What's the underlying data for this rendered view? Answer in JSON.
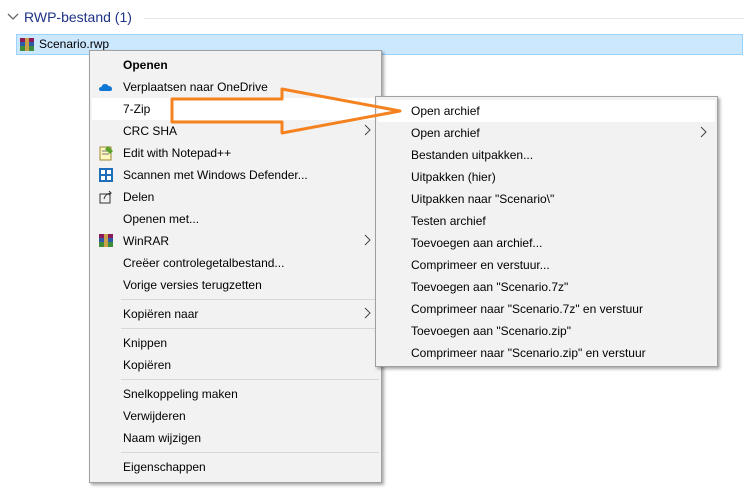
{
  "explorer": {
    "group_title": "RWP-bestand (1)",
    "file_name": "Scenario.rwp"
  },
  "context_menu": {
    "items": [
      {
        "label": "Openen",
        "bold": true
      },
      {
        "label": "Verplaatsen naar OneDrive",
        "icon": "onedrive-icon"
      },
      {
        "label": "7-Zip",
        "submenu": true
      },
      {
        "label": "CRC SHA",
        "submenu": true
      },
      {
        "label": "Edit with Notepad++",
        "icon": "notepad-plus-plus-icon"
      },
      {
        "label": "Scannen met Windows Defender...",
        "icon": "windows-defender-icon"
      },
      {
        "label": "Delen",
        "icon": "share-icon"
      },
      {
        "label": "Openen met..."
      },
      {
        "label": "WinRAR",
        "icon": "winrar-icon",
        "submenu": true
      },
      {
        "label": "Creëer controlegetalbestand..."
      },
      {
        "label": "Vorige versies terugzetten"
      },
      {
        "label": "Kopiëren naar",
        "submenu": true
      },
      {
        "label": "Knippen"
      },
      {
        "label": "Kopiëren"
      },
      {
        "label": "Snelkoppeling maken"
      },
      {
        "label": "Verwijderen"
      },
      {
        "label": "Naam wijzigen"
      },
      {
        "label": "Eigenschappen"
      }
    ]
  },
  "zip_submenu": {
    "items": [
      {
        "label": "Open archief"
      },
      {
        "label": "Open archief",
        "submenu": true
      },
      {
        "label": "Bestanden uitpakken..."
      },
      {
        "label": "Uitpakken (hier)"
      },
      {
        "label": "Uitpakken naar \"Scenario\\\""
      },
      {
        "label": "Testen archief"
      },
      {
        "label": "Toevoegen aan archief..."
      },
      {
        "label": "Comprimeer en verstuur..."
      },
      {
        "label": "Toevoegen aan \"Scenario.7z\""
      },
      {
        "label": "Comprimeer naar \"Scenario.7z\" en verstuur"
      },
      {
        "label": "Toevoegen aan \"Scenario.zip\""
      },
      {
        "label": "Comprimeer naar \"Scenario.zip\" en verstuur"
      }
    ]
  },
  "colors": {
    "accent": "#1e3287",
    "selection": "#cce8ff",
    "annotation": "#f5821f"
  }
}
